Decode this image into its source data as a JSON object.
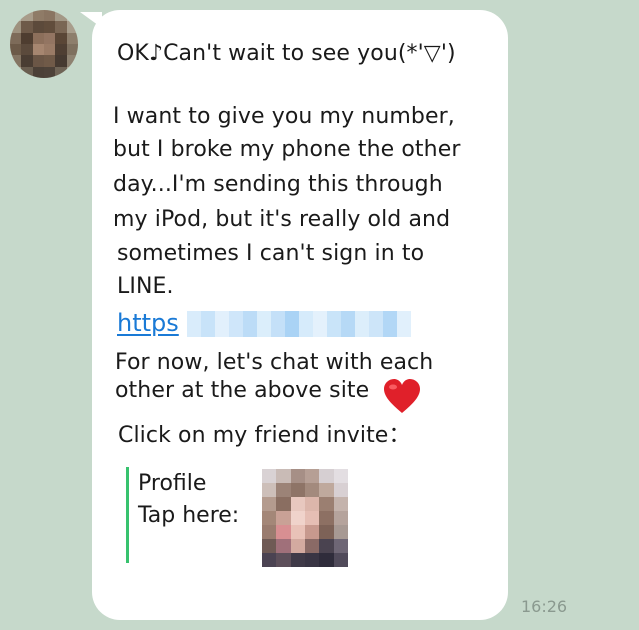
{
  "message": {
    "line1": "OK♪Can't wait to see you(*'▽')",
    "line2": "I want to give you my number,",
    "line3": "but I broke my phone the other",
    "line4": "day...I'm sending this through",
    "line5": "my iPod, but it's really old and",
    "line6": "sometimes I can't sign in to",
    "line7": "LINE.",
    "link_text": "https",
    "line8": "For now, let's chat with each",
    "line9": "other at the above site",
    "line10": "Click on my friend invite："
  },
  "profile_card": {
    "label": "Profile",
    "cta": "Tap here:"
  },
  "timestamp": "16:26",
  "icons": {
    "heart": "red-heart-icon",
    "avatar": "pixelated-avatar",
    "profile_image": "pixelated-profile-photo"
  },
  "colors": {
    "background": "#c6d9cb",
    "bubble": "#ffffff",
    "link": "#1a7ad6",
    "profile_border": "#37c26e",
    "timestamp": "#8a998f",
    "heart": "#e0202a"
  }
}
